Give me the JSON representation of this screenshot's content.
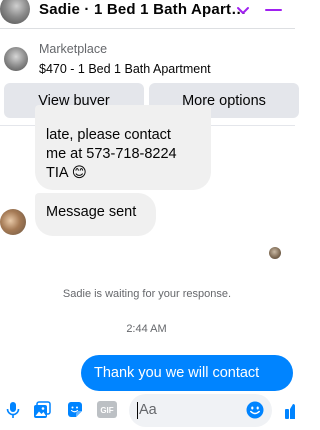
{
  "header": {
    "title": "Sadie · 1 Bed 1 Bath Apart…",
    "accent_color": "#a020f0"
  },
  "context": {
    "source": "Marketplace",
    "listing": "$470 - 1 Bed 1 Bath Apartment",
    "buttons": {
      "view_buyer": "View buyer",
      "more_options": "More options"
    }
  },
  "messages": {
    "incoming_1": {
      "lines": [
        "late,  please contact",
        "me at 573-718-8224",
        "TIA 😊"
      ]
    },
    "incoming_2": "Message sent",
    "waiting_notice": "Sadie is waiting for your response.",
    "timestamp": "2:44 AM",
    "outgoing_1": "Thank you we will contact"
  },
  "composer": {
    "placeholder": "Aa",
    "icons": [
      "microphone-icon",
      "photo-icon",
      "sticker-icon",
      "gif-icon",
      "emoji-icon",
      "like-icon"
    ],
    "gif_label": "GIF",
    "accent_color": "#0084ff"
  }
}
